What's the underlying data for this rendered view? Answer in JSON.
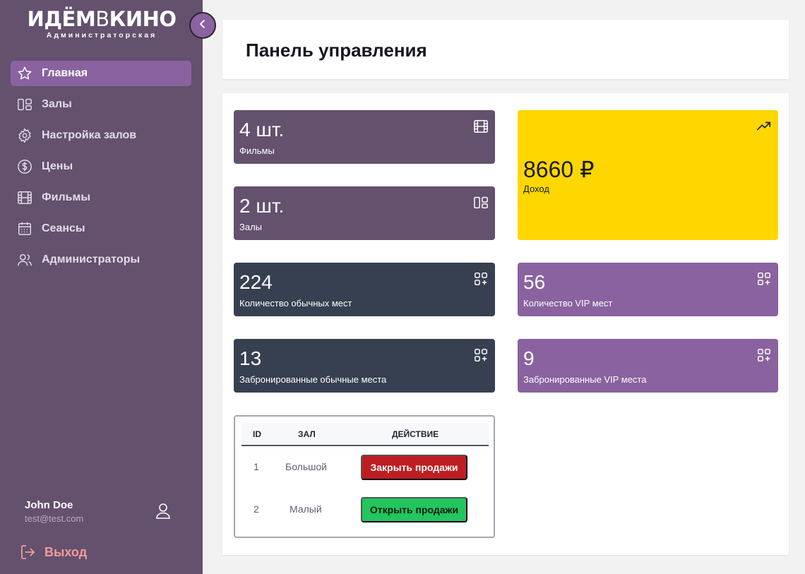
{
  "sidebar": {
    "logo": {
      "bold1": "ИДЁМ",
      "thin": "В",
      "bold2": "КИНО",
      "subtitle": "Администраторская"
    },
    "items": [
      {
        "label": "Главная",
        "icon": "star-icon",
        "active": true
      },
      {
        "label": "Залы",
        "icon": "layout-icon"
      },
      {
        "label": "Настройка залов",
        "icon": "gear-icon"
      },
      {
        "label": "Цены",
        "icon": "dollar-icon"
      },
      {
        "label": "Фильмы",
        "icon": "film-icon"
      },
      {
        "label": "Сеансы",
        "icon": "calendar-icon"
      },
      {
        "label": "Администраторы",
        "icon": "users-icon"
      }
    ],
    "user": {
      "name": "John Doe",
      "email": "test@test.com"
    },
    "logout_label": "Выход"
  },
  "header": {
    "title": "Панель управления"
  },
  "stats": {
    "films": {
      "value": "4 шт.",
      "label": "Фильмы"
    },
    "halls": {
      "value": "2 шт.",
      "label": "Залы"
    },
    "revenue": {
      "value": "8660 ₽",
      "label": "Доход"
    },
    "regular_seats": {
      "value": "224",
      "label": "Количество обычных мест"
    },
    "vip_seats": {
      "value": "56",
      "label": "Количество VIP мест"
    },
    "booked_regular": {
      "value": "13",
      "label": "Забронированные обычные места"
    },
    "booked_vip": {
      "value": "9",
      "label": "Забронированные VIP места"
    }
  },
  "table": {
    "headers": [
      "ID",
      "ЗАЛ",
      "ДЕЙСТВИЕ"
    ],
    "rows": [
      {
        "id": "1",
        "hall": "Большой",
        "action": "Закрыть продажи",
        "action_color": "#be1e22"
      },
      {
        "id": "2",
        "hall": "Малый",
        "action": "Открыть продажи",
        "action_color": "#22c55e"
      }
    ]
  },
  "colors": {
    "sidebar": "#63516e",
    "accent": "#8a629f",
    "slate": "#364050",
    "yellow": "#fed600"
  }
}
